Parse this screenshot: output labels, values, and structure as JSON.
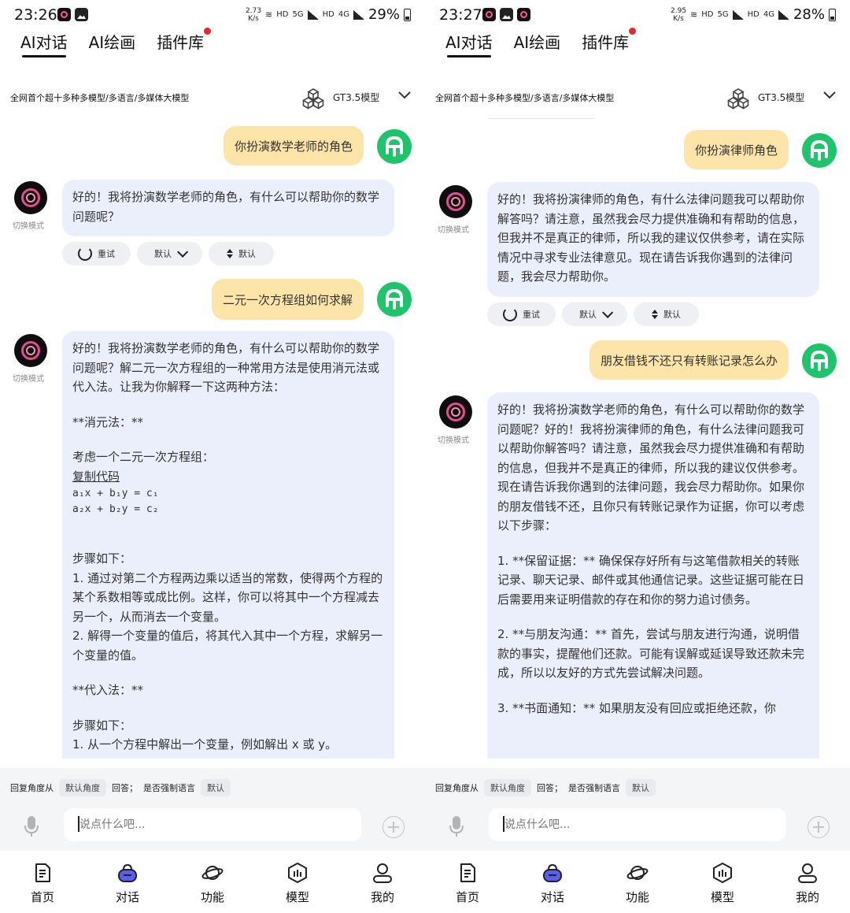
{
  "panels": [
    {
      "status_bar": {
        "time": "23:26",
        "net_speed_value": "2.73",
        "net_speed_unit": "K/s",
        "hd1": "HD",
        "net1": "5G",
        "hd2": "HD",
        "net2": "4G",
        "battery": "29%"
      },
      "tabs": [
        {
          "label": "AI对话"
        },
        {
          "label": "AI绘画"
        },
        {
          "label": "插件库"
        }
      ],
      "model_bar": {
        "description": "全网首个超十多种多模型/多语言/多媒体大模型",
        "model_name": "GT3.5模型"
      },
      "messages": {
        "q1": "你扮演数学老师的角色",
        "switch_mode": "切换模式",
        "a1": [
          "好的！我将扮演数学老师的角色，有什么可以帮助你的数学问题呢？"
        ],
        "actions": {
          "retry": "重试",
          "default_select": "默认",
          "default_sort": "默认"
        },
        "q2": "二元一次方程组如何求解",
        "a2": {
          "intro": "好的！我将扮演数学老师的角色，有什么可以帮助你的数学问题呢？解二元一次方程组的一种常用方法是使用消元法或代入法。让我为你解释一下这两种方法：",
          "elim_title": "**消元法：**",
          "consider": "考虑一个二元一次方程组：",
          "copy_code": "复制代码",
          "code": [
            "a₁x + b₁y = c₁",
            "a₂x + b₂y = c₂"
          ],
          "steps_title": "步骤如下：",
          "step1": "1. 通过对第二个方程两边乘以适当的常数，使得两个方程的某个系数相等或成比例。这样，你可以将其中一个方程减去另一个，从而消去一个变量。",
          "step2": "2. 解得一个变量的值后，将其代入其中一个方程，求解另一个变量的值。",
          "sub_title": "**代入法：**",
          "steps_title2": "步骤如下：",
          "sub_step1": "1. 从一个方程中解出一个变量，例如解出 x 或 y。"
        }
      },
      "settings": {
        "prefix": "回复角度从",
        "angle_chip": "默认角度",
        "answer": "回答；",
        "force_lang": "是否强制语言",
        "lang_chip": "默认"
      },
      "input": {
        "placeholder": "说点什么吧..."
      },
      "nav": [
        {
          "label": "首页"
        },
        {
          "label": "对话"
        },
        {
          "label": "功能"
        },
        {
          "label": "模型"
        },
        {
          "label": "我的"
        }
      ]
    },
    {
      "status_bar": {
        "time": "23:27",
        "net_speed_value": "2.95",
        "net_speed_unit": "K/s",
        "hd1": "HD",
        "net1": "5G",
        "hd2": "HD",
        "net2": "4G",
        "battery": "28%"
      },
      "tabs": [
        {
          "label": "AI对话"
        },
        {
          "label": "AI绘画"
        },
        {
          "label": "插件库"
        }
      ],
      "model_bar": {
        "description": "全网首个超十多种多模型/多语言/多媒体大模型",
        "model_name": "GT3.5模型"
      },
      "messages": {
        "q1": "你扮演律师角色",
        "switch_mode": "切换模式",
        "a1": "好的！我将扮演律师的角色，有什么法律问题我可以帮助你解答吗？请注意，虽然我会尽力提供准确和有帮助的信息，但我并不是真正的律师，所以我的建议仅供参考，请在实际情况中寻求专业法律意见。现在请告诉我你遇到的法律问题，我会尽力帮助你。",
        "actions": {
          "retry": "重试",
          "default_select": "默认",
          "default_sort": "默认"
        },
        "q2": "朋友借钱不还只有转账记录怎么办",
        "a2": {
          "intro": "好的！我将扮演数学老师的角色，有什么可以帮助你的数学问题呢？好的！我将扮演律师的角色，有什么法律问题我可以帮助你解答吗？请注意，虽然我会尽力提供准确和有帮助的信息，但我并不是真正的律师，所以我的建议仅供参考。现在请告诉我你遇到的法律问题，我会尽力帮助你。如果你的朋友借钱不还，且你只有转账记录作为证据，你可以考虑以下步骤：",
          "p1": "1. **保留证据：** 确保保存好所有与这笔借款相关的转账记录、聊天记录、邮件或其他通信记录。这些证据可能在日后需要用来证明借款的存在和你的努力追讨债务。",
          "p2": "2. **与朋友沟通：** 首先，尝试与朋友进行沟通，说明借款的事实，提醒他们还款。可能有误解或延误导致还款未完成，所以以友好的方式先尝试解决问题。",
          "p3": "3. **书面通知：** 如果朋友没有回应或拒绝还款，你"
        }
      },
      "settings": {
        "prefix": "回复角度从",
        "angle_chip": "默认角度",
        "answer": "回答；",
        "force_lang": "是否强制语言",
        "lang_chip": "默认"
      },
      "input": {
        "placeholder": "说点什么吧..."
      },
      "nav": [
        {
          "label": "首页"
        },
        {
          "label": "对话"
        },
        {
          "label": "功能"
        },
        {
          "label": "模型"
        },
        {
          "label": "我的"
        }
      ]
    }
  ],
  "colors": {
    "user_bubble": "#fde5aa",
    "bot_bubble": "#eaeffb",
    "user_avatar": "#1ec36b",
    "nav_active": "#5b5ff0",
    "badge_red": "#e8262b"
  },
  "icons": [
    "mic-icon",
    "plus-icon",
    "home-doc-icon",
    "chat-bag-icon",
    "planet-icon",
    "cube-icon",
    "person-icon",
    "retry-icon",
    "chevron-down-icon",
    "sort-icon",
    "model-cube-icon"
  ]
}
